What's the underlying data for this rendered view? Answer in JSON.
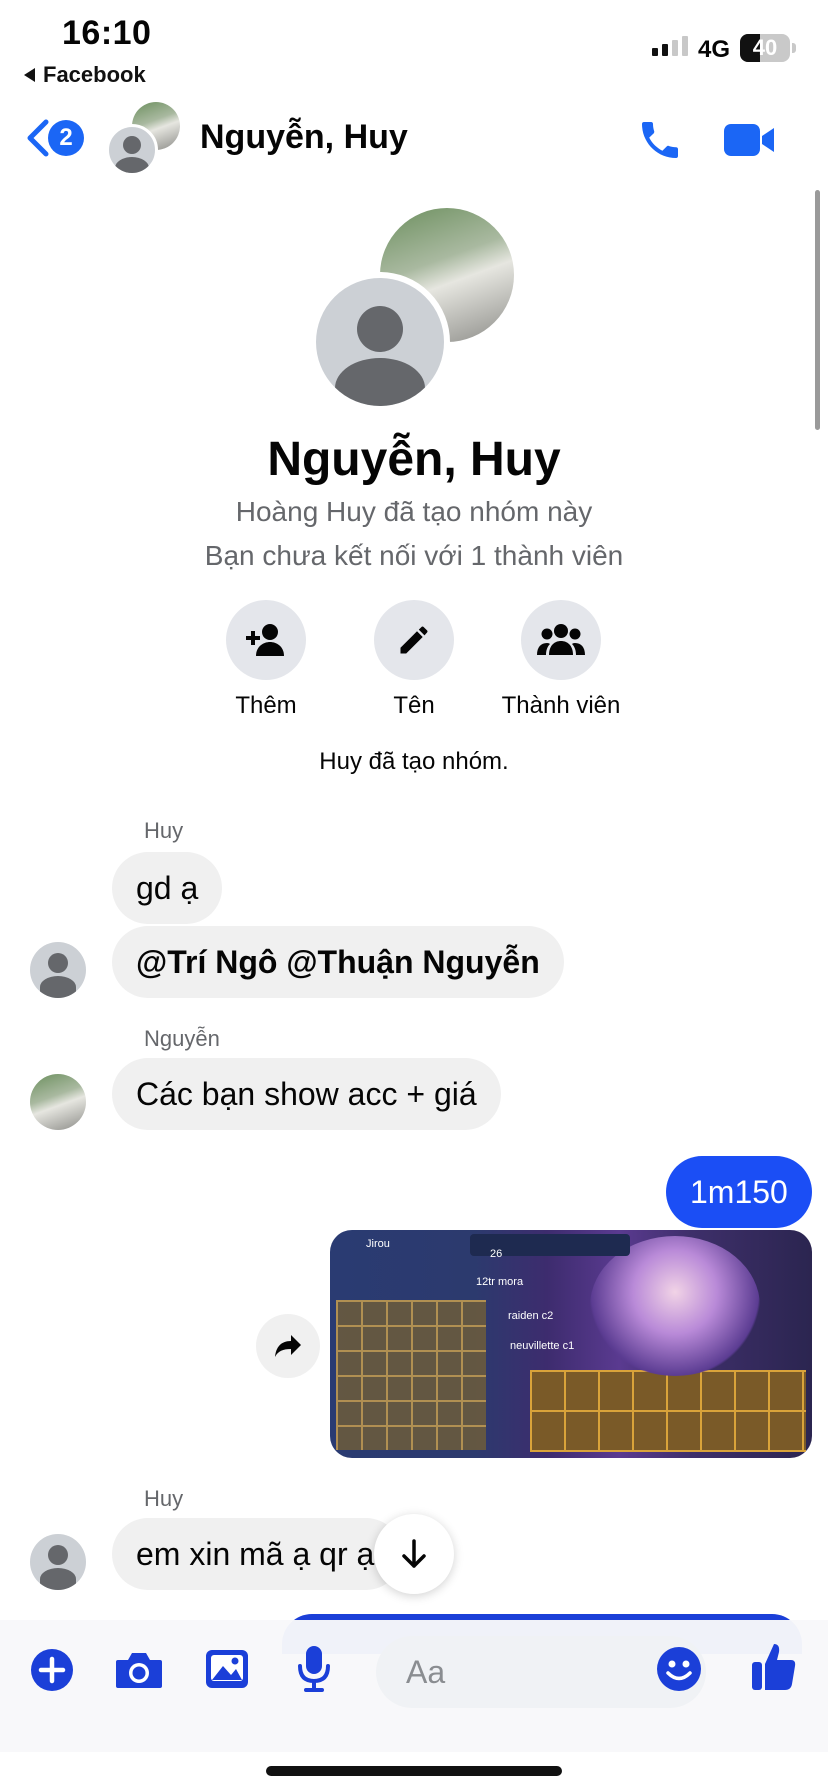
{
  "status_bar": {
    "time": "16:10",
    "back_app_label": "Facebook",
    "network": "4G",
    "battery": "40"
  },
  "header": {
    "unread_count": "2",
    "title": "Nguyễn, Huy"
  },
  "group_info": {
    "name": "Nguyễn, Huy",
    "created_by": "Hoàng Huy đã tạo nhóm này",
    "connection_note": "Bạn chưa kết nối với 1 thành viên",
    "actions": [
      {
        "label": "Thêm",
        "icon": "add-person-icon"
      },
      {
        "label": "Tên",
        "icon": "pencil-icon"
      },
      {
        "label": "Thành viên",
        "icon": "group-icon"
      }
    ]
  },
  "system_message": "Huy đã tạo nhóm.",
  "messages": [
    {
      "sender": "Huy",
      "text": "gd ạ"
    },
    {
      "text_mention": "@Trí Ngô @Thuận Nguyễn"
    },
    {
      "sender": "Nguyễn",
      "text": "Các bạn show acc + giá"
    },
    {
      "sender": "me",
      "text": "1m150"
    },
    {
      "sender": "Huy",
      "text": "em xin mã ạ qr ạ"
    }
  ],
  "image_message": {
    "overlay_texts": [
      "Jirou",
      "26",
      "12tr mora",
      "raiden c2",
      "neuvillette c1"
    ]
  },
  "composer": {
    "placeholder": "Aa"
  },
  "colors": {
    "accent": "#1b66f5",
    "my_bubble": "#1b4ef5",
    "other_bubble": "#f0f0f0",
    "secondary_text": "#65676b"
  }
}
